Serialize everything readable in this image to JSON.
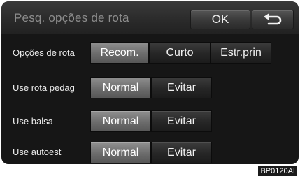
{
  "header": {
    "title": "Pesq. opções de rota",
    "ok_label": "OK",
    "back_icon": "back-arrow-icon"
  },
  "rows": [
    {
      "label": "Opções de rota",
      "options": [
        "Recom.",
        "Curto",
        "Estr.prin"
      ],
      "selected": "Recom."
    },
    {
      "label": "Use rota pedag",
      "options": [
        "Normal",
        "Evitar"
      ],
      "selected": "Normal"
    },
    {
      "label": "Use balsa",
      "options": [
        "Normal",
        "Evitar"
      ],
      "selected": "Normal"
    },
    {
      "label": "Use autoest",
      "options": [
        "Normal",
        "Evitar"
      ],
      "selected": "Normal"
    }
  ],
  "figure_code": "BP0120AI"
}
